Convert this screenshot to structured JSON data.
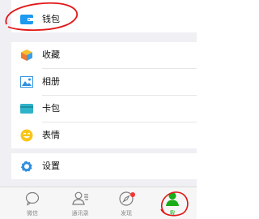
{
  "menu": {
    "wallet": "钱包",
    "favorites": "收藏",
    "album": "相册",
    "cards": "卡包",
    "stickers": "表情",
    "settings": "设置"
  },
  "tabbar": {
    "tabs": [
      {
        "label": "微信"
      },
      {
        "label": "通讯录"
      },
      {
        "label": "发现"
      },
      {
        "label": "我"
      }
    ],
    "active_tab": "我",
    "discover_badge": "dot"
  },
  "colors": {
    "accent_green": "#1aad19",
    "wallet_blue": "#1e9af0",
    "badge_red": "#f43530",
    "annotation_red": "#e01818",
    "background_gray": "#efeff4"
  },
  "icons": {
    "wallet": "wallet-icon",
    "favorites": "favorites-cube-icon",
    "album": "album-picture-icon",
    "cards": "card-wallet-icon",
    "stickers": "smile-face-icon",
    "settings": "gear-icon"
  }
}
